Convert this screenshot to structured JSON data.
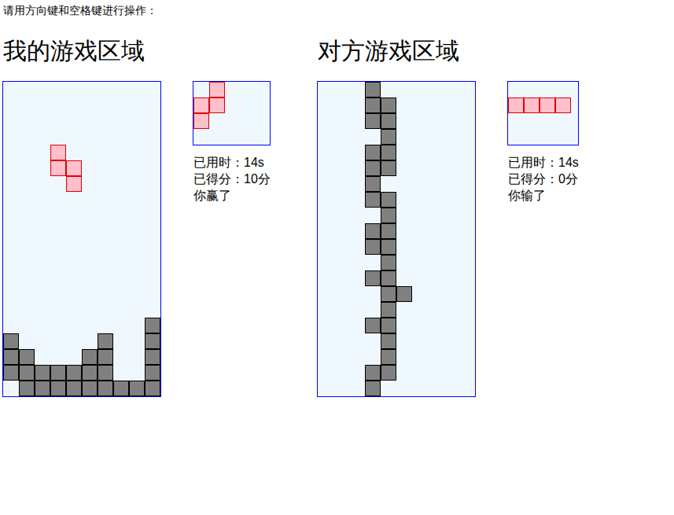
{
  "instruction": "请用方向键和空格键进行操作：",
  "players": [
    {
      "title": "我的游戏区域",
      "time": "已用时：14s",
      "score": "已得分：10分",
      "result": "你赢了",
      "board": {
        "settled": [
          [
            9,
            15
          ],
          [
            0,
            16
          ],
          [
            6,
            16
          ],
          [
            9,
            16
          ],
          [
            0,
            17
          ],
          [
            1,
            17
          ],
          [
            5,
            17
          ],
          [
            6,
            17
          ],
          [
            9,
            17
          ],
          [
            0,
            18
          ],
          [
            1,
            18
          ],
          [
            2,
            18
          ],
          [
            3,
            18
          ],
          [
            4,
            18
          ],
          [
            5,
            18
          ],
          [
            6,
            18
          ],
          [
            9,
            18
          ],
          [
            1,
            19
          ],
          [
            2,
            19
          ],
          [
            3,
            19
          ],
          [
            4,
            19
          ],
          [
            5,
            19
          ],
          [
            6,
            19
          ],
          [
            7,
            19
          ],
          [
            8,
            19
          ],
          [
            9,
            19
          ]
        ],
        "falling": [
          [
            3,
            4
          ],
          [
            3,
            5
          ],
          [
            4,
            5
          ],
          [
            4,
            6
          ]
        ]
      },
      "next": [
        [
          1,
          0
        ],
        [
          0,
          1
        ],
        [
          1,
          1
        ],
        [
          0,
          2
        ]
      ]
    },
    {
      "title": "对方游戏区域",
      "time": "已用时：14s",
      "score": "已得分：0分",
      "result": "你输了",
      "board": {
        "settled": [
          [
            3,
            0
          ],
          [
            3,
            1
          ],
          [
            4,
            1
          ],
          [
            3,
            2
          ],
          [
            4,
            2
          ],
          [
            4,
            3
          ],
          [
            3,
            4
          ],
          [
            4,
            4
          ],
          [
            3,
            5
          ],
          [
            4,
            5
          ],
          [
            3,
            6
          ],
          [
            3,
            7
          ],
          [
            4,
            7
          ],
          [
            4,
            8
          ],
          [
            3,
            9
          ],
          [
            4,
            9
          ],
          [
            3,
            10
          ],
          [
            4,
            10
          ],
          [
            4,
            11
          ],
          [
            3,
            12
          ],
          [
            4,
            12
          ],
          [
            4,
            13
          ],
          [
            5,
            13
          ],
          [
            4,
            14
          ],
          [
            3,
            15
          ],
          [
            4,
            15
          ],
          [
            4,
            16
          ],
          [
            4,
            17
          ],
          [
            3,
            18
          ],
          [
            4,
            18
          ],
          [
            3,
            19
          ]
        ],
        "falling": []
      },
      "next": [
        [
          0,
          1
        ],
        [
          1,
          1
        ],
        [
          2,
          1
        ],
        [
          3,
          1
        ]
      ]
    }
  ]
}
